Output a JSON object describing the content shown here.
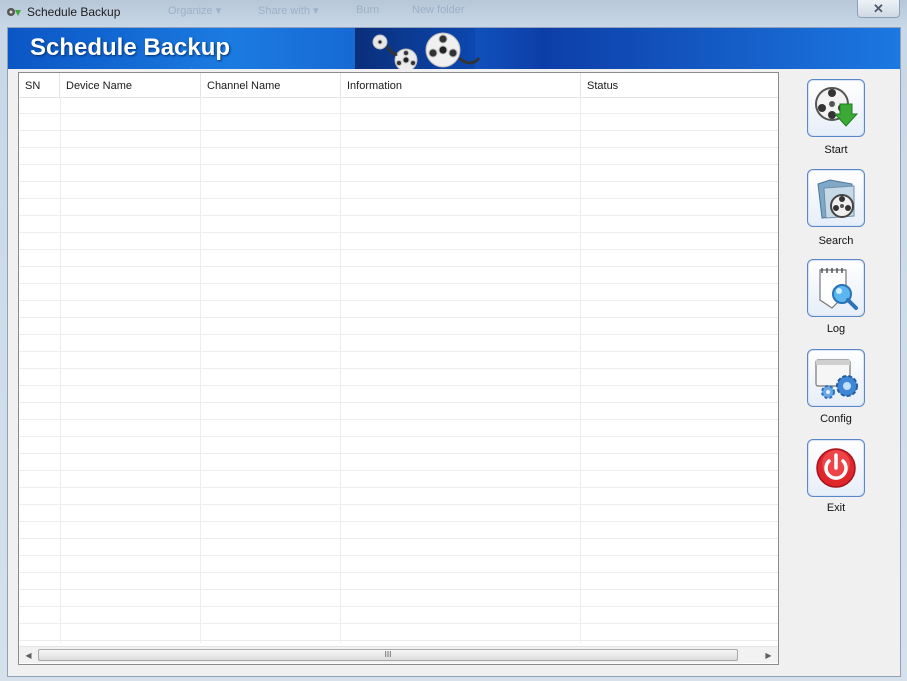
{
  "window": {
    "title": "Schedule Backup",
    "close_symbol": "✕",
    "background_menu": [
      "Organize ▾",
      "Share with ▾",
      "Burn",
      "New folder"
    ]
  },
  "banner": {
    "title": "Schedule Backup"
  },
  "table": {
    "columns": [
      "SN",
      "Device Name",
      "Channel Name",
      "Information",
      "Status"
    ],
    "rows": [],
    "scroll_grip": "III"
  },
  "actions": {
    "start": {
      "label": "Start",
      "icon": "film-reel-download-icon"
    },
    "search": {
      "label": "Search",
      "icon": "folder-film-reel-icon"
    },
    "log": {
      "label": "Log",
      "icon": "notepad-magnifier-icon"
    },
    "config": {
      "label": "Config",
      "icon": "window-gears-icon"
    },
    "exit": {
      "label": "Exit",
      "icon": "power-icon"
    }
  },
  "colors": {
    "banner_blue": "#1565d6",
    "button_border": "#5b86c7",
    "exit_red": "#e0252b",
    "start_green": "#3aa936"
  }
}
